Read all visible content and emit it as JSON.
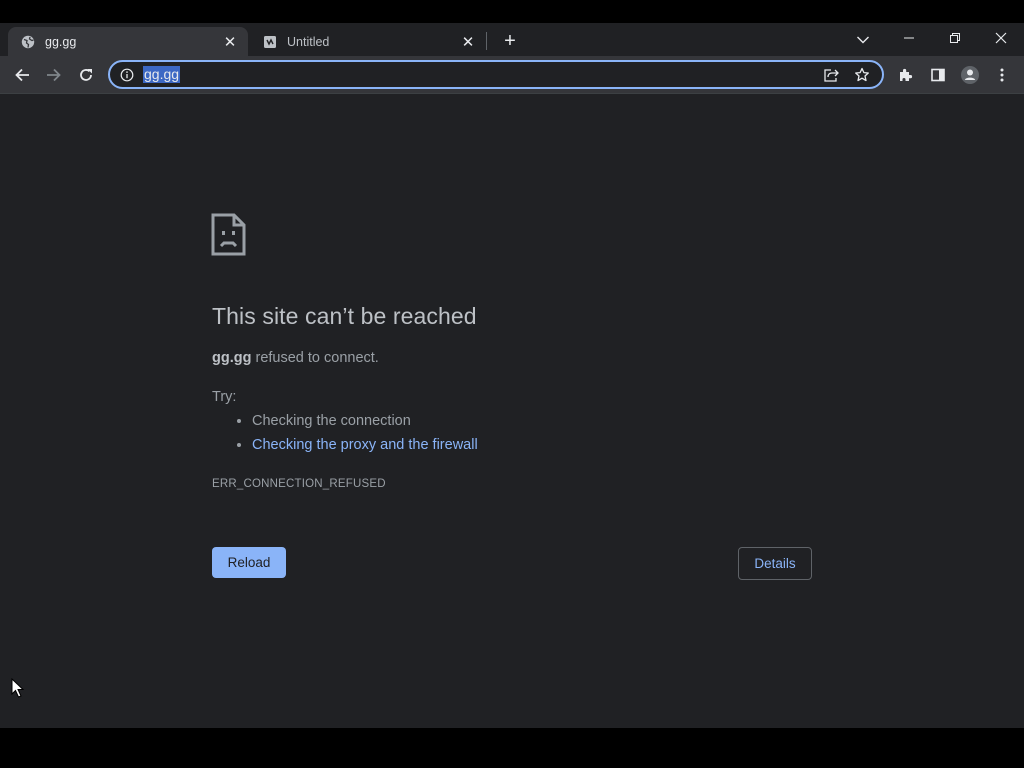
{
  "browser": {
    "tabs": [
      {
        "title": "gg.gg",
        "icon": "globe-icon",
        "active": true
      },
      {
        "title": "Untitled",
        "icon": "document-icon",
        "active": false
      }
    ],
    "newtab_label": "+",
    "address": {
      "url": "gg.gg"
    }
  },
  "error_page": {
    "heading": "This site can’t be reached",
    "host": "gg.gg",
    "summary_rest": " refused to connect.",
    "try_label": "Try:",
    "suggestions": [
      "Checking the connection",
      "Checking the proxy and the firewall"
    ],
    "error_code": "ERR_CONNECTION_REFUSED",
    "reload_label": "Reload",
    "details_label": "Details"
  },
  "colors": {
    "frame": "#202124",
    "toolbar": "#35363a",
    "accent": "#8ab4f8",
    "text_primary": "#bdc1c6",
    "text_secondary": "#9aa0a6"
  }
}
